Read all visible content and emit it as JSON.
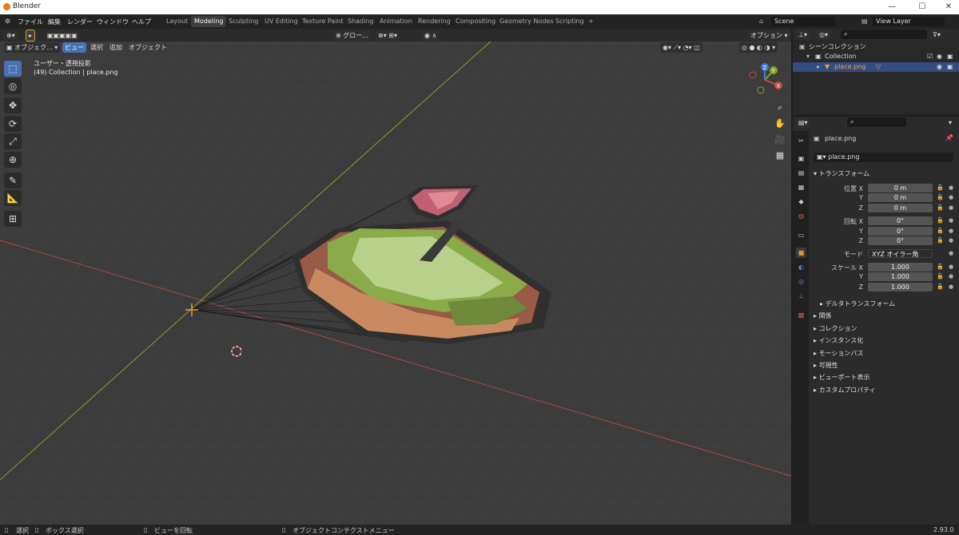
{
  "window": {
    "title": "Blender",
    "minimize": "—",
    "maximize": "☐",
    "close": "✕"
  },
  "menu": [
    "ファイル",
    "編集",
    "レンダー",
    "ウィンドウ",
    "ヘルプ"
  ],
  "workspaces": [
    "Layout",
    "Modeling",
    "Sculpting",
    "UV Editing",
    "Texture Paint",
    "Shading",
    "Animation",
    "Rendering",
    "Compositing",
    "Geometry Nodes",
    "Scripting",
    "+"
  ],
  "active_workspace": "Modeling",
  "scene": {
    "name": "Scene",
    "view_layer": "View Layer"
  },
  "viewport_header": {
    "mode": "オブジェク...",
    "menus": [
      "ビュー",
      "選択",
      "追加",
      "オブジェクト"
    ],
    "transform_orientation": "グロー...",
    "options": "オプション"
  },
  "overlay": {
    "view_name": "ユーザー・透視投影",
    "context": "(49) Collection | place.png"
  },
  "gizmo": {
    "x": "X",
    "y": "Y",
    "z": "Z"
  },
  "outliner": {
    "scene_collection": "シーンコレクション",
    "collection": "Collection",
    "object": "place.png"
  },
  "properties": {
    "object_name": "place.png",
    "data_name": "place.png",
    "transform_title": "トランスフォーム",
    "location_label": "位置 X",
    "rotation_label": "回転 X",
    "scale_label": "スケール X",
    "y_label": "Y",
    "z_label": "Z",
    "location": [
      "0 m",
      "0 m",
      "0 m"
    ],
    "rotation": [
      "0°",
      "0°",
      "0°"
    ],
    "mode_label": "モード",
    "mode_value": "XYZ オイラー角",
    "scale": [
      "1.000",
      "1.000",
      "1.000"
    ],
    "delta": "デルタトランスフォーム",
    "sections": [
      "関係",
      "コレクション",
      "インスタンス化",
      "モーションパス",
      "可視性",
      "ビューポート表示",
      "カスタムプロパティ"
    ]
  },
  "statusbar": {
    "select": "選択",
    "box_select": "ボックス選択",
    "rotate_view": "ビューを回転",
    "context_menu": "オブジェクトコンテクストメニュー",
    "version": "2.93.0"
  },
  "colors": {
    "accent": "#4772b3",
    "grid_bg": "#3c3c3c",
    "x_axis": "#c94a4a",
    "y_axis": "#8aa02a",
    "origin": "#e89a2a"
  }
}
